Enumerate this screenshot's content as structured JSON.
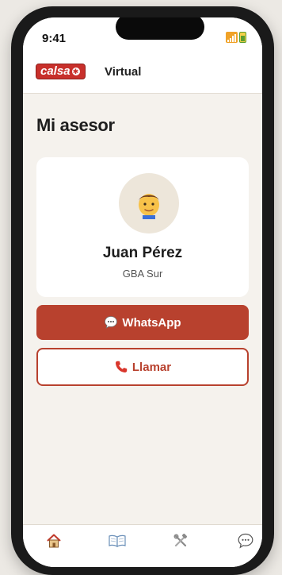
{
  "status_bar": {
    "time": "9:41",
    "icons": [
      "signal-icon",
      "battery-icon"
    ]
  },
  "header": {
    "logo_text": "calsa",
    "title": "Virtual"
  },
  "page": {
    "title": "Mi asesor"
  },
  "advisor": {
    "avatar_icon": "man-face-icon",
    "name": "Juan Pérez",
    "zone": "GBA Sur"
  },
  "actions": {
    "whatsapp_icon": "speech-bubble-icon",
    "whatsapp_label": "WhatsApp",
    "call_icon": "phone-icon",
    "call_label": "Llamar"
  },
  "tab_bar": {
    "tabs": [
      {
        "icon": "home-icon"
      },
      {
        "icon": "book-icon"
      },
      {
        "icon": "tools-icon"
      },
      {
        "icon": "chat-bubble-icon"
      }
    ]
  },
  "colors": {
    "accent": "#b8412e",
    "brand": "#c8302b",
    "background": "#f5f2ed"
  }
}
